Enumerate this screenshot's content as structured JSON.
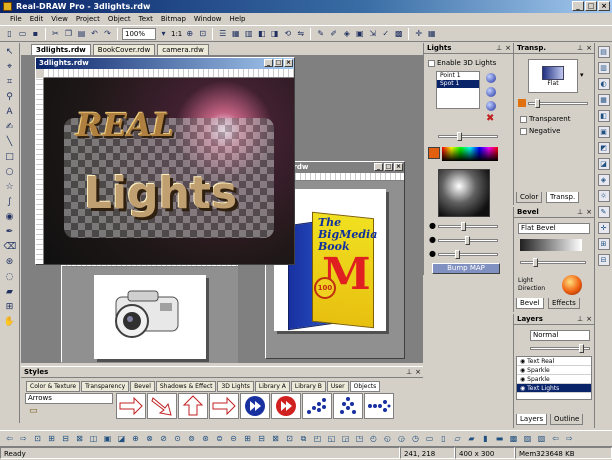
{
  "window": {
    "title": "Real-DRAW Pro - 3dlights.rdw",
    "minimize": "_",
    "maximize": "□",
    "close": "×"
  },
  "menu": [
    "File",
    "Edit",
    "View",
    "Project",
    "Object",
    "Text",
    "Bitmap",
    "Window",
    "Help"
  ],
  "toolbar": {
    "zoom": "100%",
    "ratio": "1:1"
  },
  "tabs": [
    "3dlights.rdw",
    "BookCover.rdw",
    "camera.rdw"
  ],
  "docs": {
    "lights": {
      "title": "3dlights.rdw",
      "line1": "REAL",
      "line2": "Lights"
    },
    "cover": {
      "title": "Cover.rdw",
      "book_title": "The BigMedia Book",
      "book_seal": "100",
      "book_letter": "M"
    }
  },
  "styles": {
    "title": "Styles",
    "tabs": [
      "Color & Texture",
      "Transparency",
      "Bevel",
      "Shadows & Effect",
      "3D Lights",
      "Library A",
      "Library B",
      "User",
      "Objects"
    ],
    "active_tab": "Objects",
    "category": "Arrows"
  },
  "lights_panel": {
    "title": "Lights",
    "enable_label": "Enable 3D Lights",
    "points": [
      "Point 1",
      "Spot 1"
    ],
    "bump_button": "Bump MAP"
  },
  "transp_panel": {
    "title": "Transp.",
    "mode": "Flat",
    "transparent_label": "Transparent",
    "negative_label": "Negative",
    "tabs": [
      "Color",
      "Transp."
    ]
  },
  "bevel_panel": {
    "title": "Bevel",
    "type": "Flat Bevel",
    "light_label": "Light Direction",
    "tabs": [
      "Bevel",
      "Effects"
    ]
  },
  "layers_panel": {
    "title": "Layers",
    "blend": "Normal",
    "items": [
      "Text Real",
      "Sparkle",
      "Sparkle",
      "Text Lights"
    ],
    "tabs": [
      "Layers",
      "Outline"
    ]
  },
  "status": {
    "ready": "Ready",
    "coords": "241, 218",
    "size": "400 x 300",
    "mem": "Mem323648 KB"
  },
  "colors": {
    "title_dark": "#0a246a",
    "title_light": "#a6caf0",
    "face": "#d4d0c8"
  }
}
